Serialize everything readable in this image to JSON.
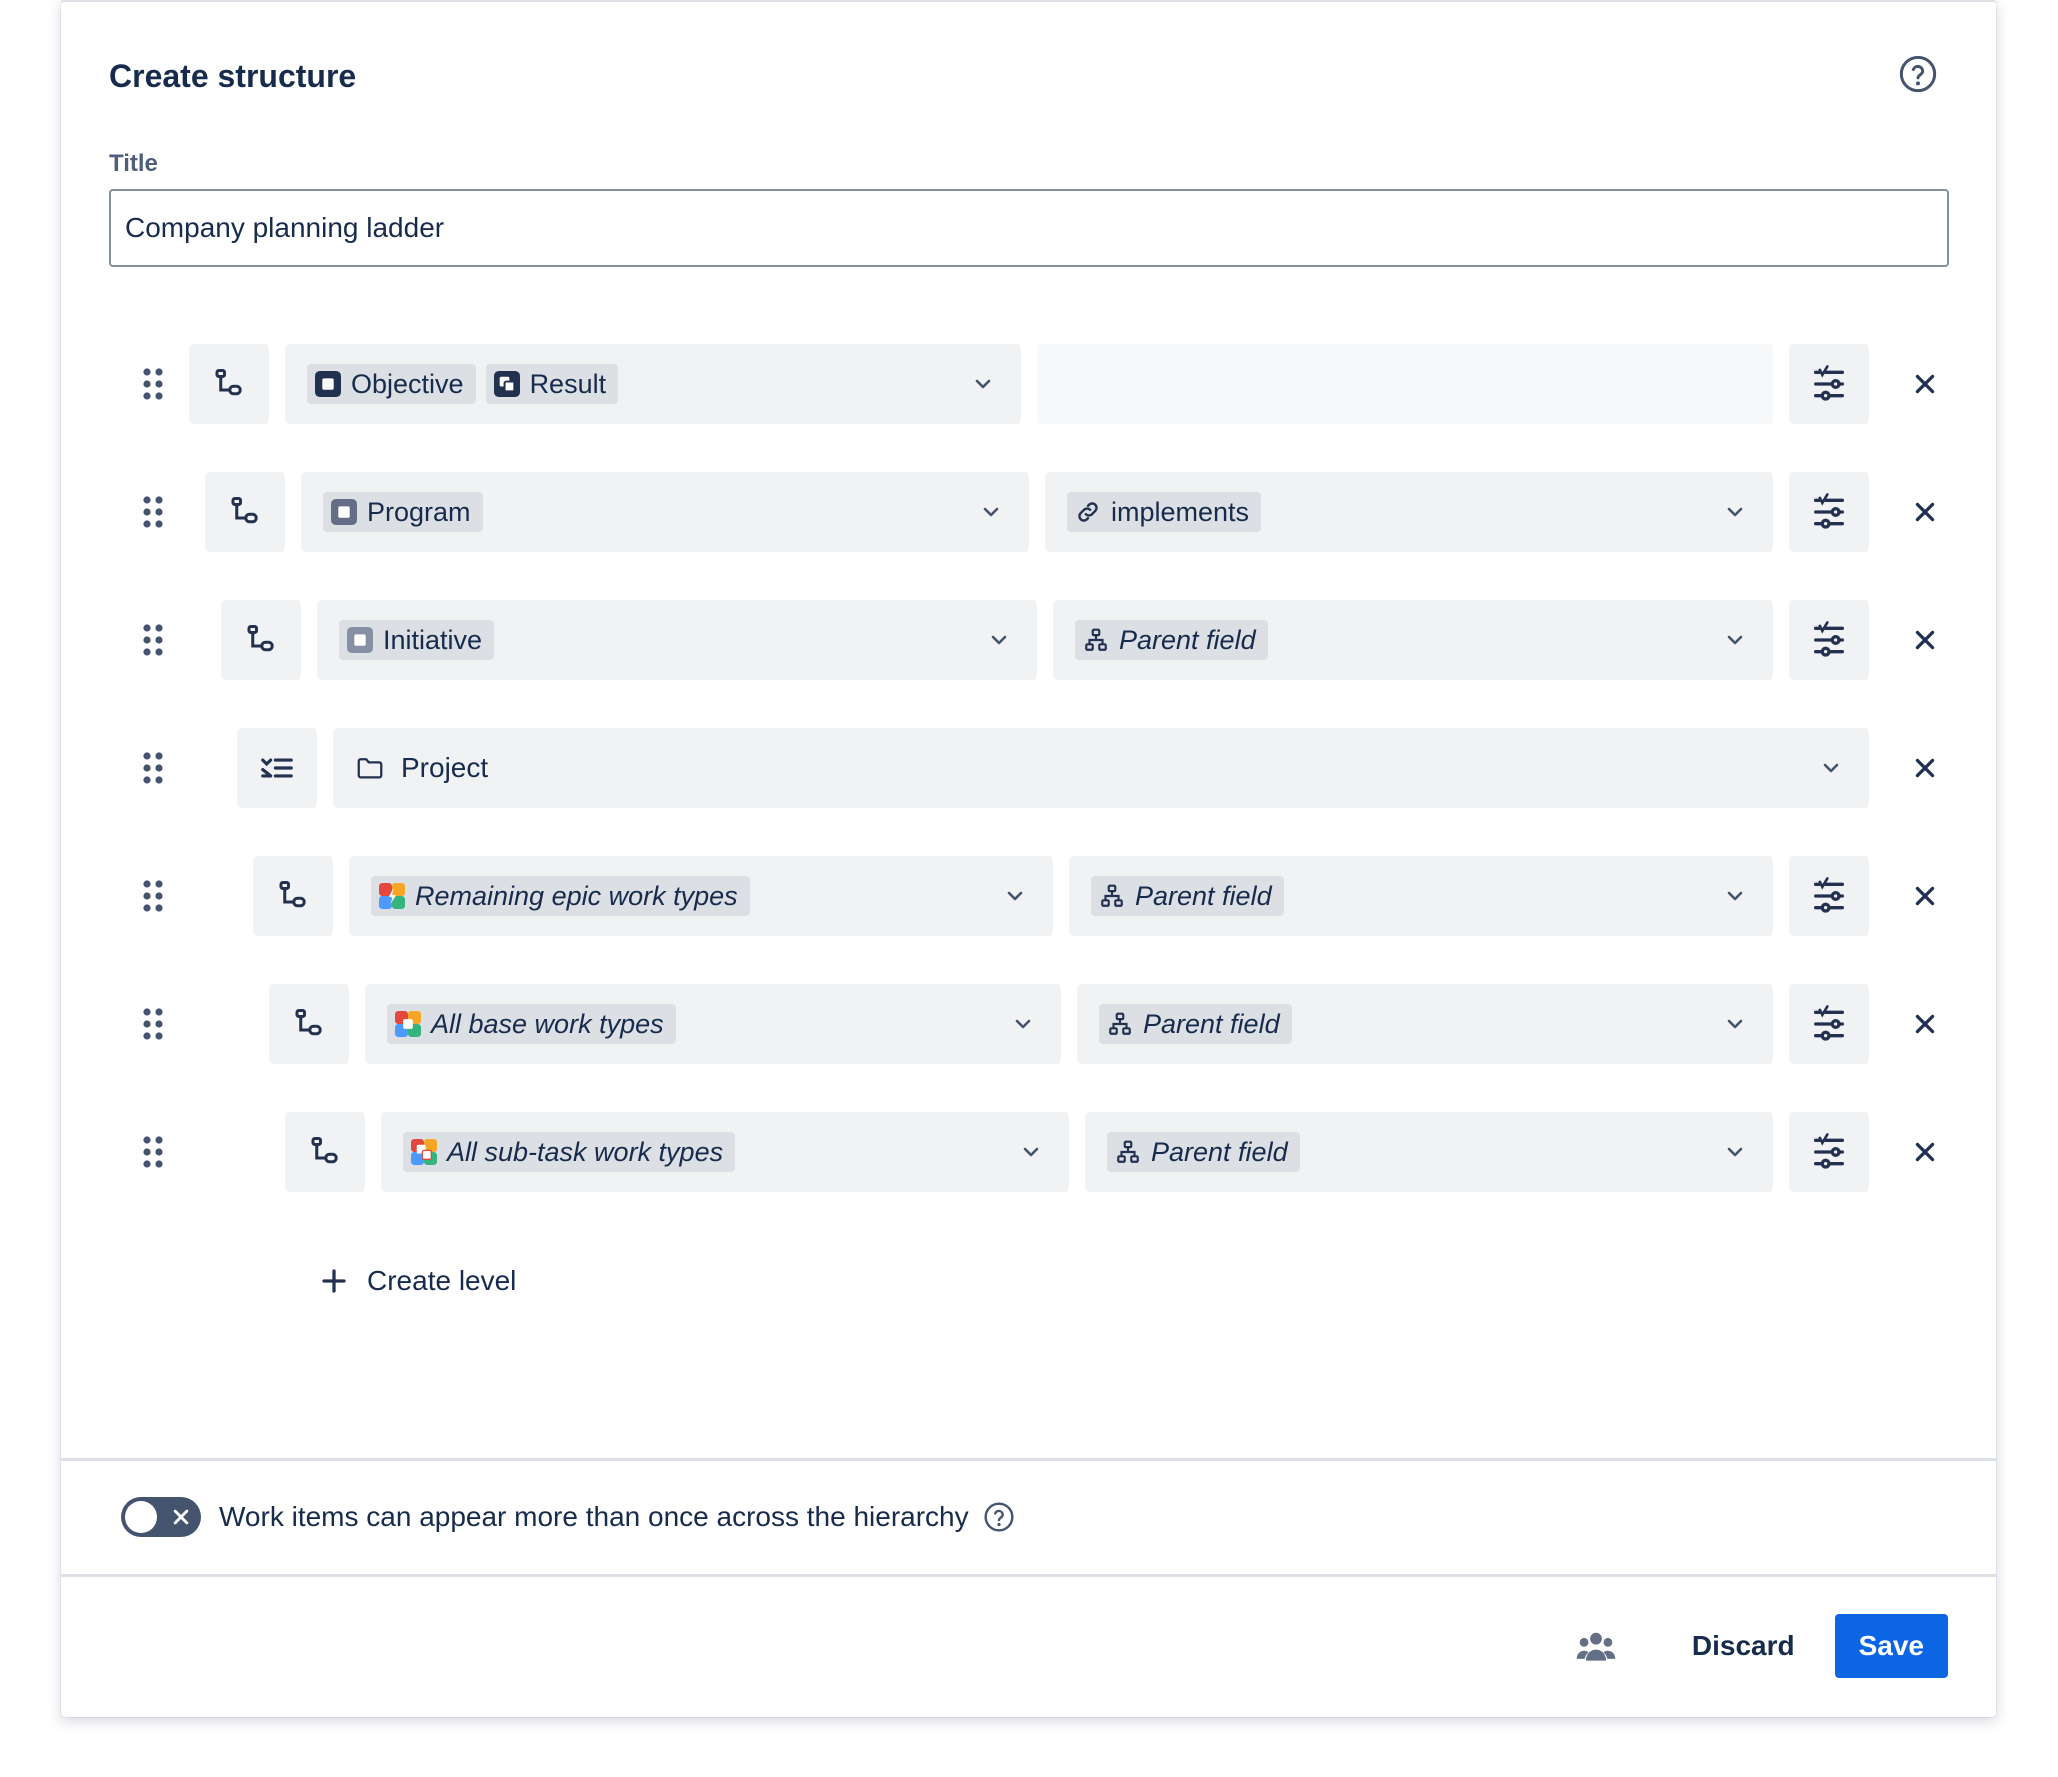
{
  "dialog": {
    "title": "Create structure",
    "help_icon": "question-circle-icon"
  },
  "title_field": {
    "label": "Title",
    "value": "Company planning ladder"
  },
  "levels": [
    {
      "mode_icon": "hierarchy-insert-icon",
      "items": [
        {
          "label": "Objective",
          "icon": "objective-icon"
        },
        {
          "label": "Result",
          "icon": "result-icon"
        }
      ],
      "relation": null
    },
    {
      "mode_icon": "hierarchy-insert-icon",
      "items": [
        {
          "label": "Program",
          "icon": "program-icon"
        }
      ],
      "relation": {
        "label": "implements",
        "icon": "link-icon"
      }
    },
    {
      "mode_icon": "hierarchy-insert-icon",
      "items": [
        {
          "label": "Initiative",
          "icon": "initiative-icon"
        }
      ],
      "relation": {
        "label": "Parent field",
        "icon": "hierarchy-icon"
      }
    },
    {
      "mode_icon": "group-by-icon",
      "value": {
        "label": "Project",
        "icon": "folder-icon"
      }
    },
    {
      "mode_icon": "hierarchy-insert-icon",
      "items": [
        {
          "label": "Remaining epic work types",
          "icon": "epic-types-icon"
        }
      ],
      "relation": {
        "label": "Parent field",
        "icon": "hierarchy-icon"
      }
    },
    {
      "mode_icon": "hierarchy-insert-icon",
      "items": [
        {
          "label": "All base work types",
          "icon": "base-types-icon"
        }
      ],
      "relation": {
        "label": "Parent field",
        "icon": "hierarchy-icon"
      }
    },
    {
      "mode_icon": "hierarchy-insert-icon",
      "items": [
        {
          "label": "All sub-task work types",
          "icon": "subtask-types-icon"
        }
      ],
      "relation": {
        "label": "Parent field",
        "icon": "hierarchy-icon"
      }
    }
  ],
  "create_level": {
    "label": "Create level",
    "icon": "plus-icon"
  },
  "duplicates_toggle": {
    "label": "Work items can appear more than once across the hierarchy",
    "state": "off"
  },
  "footer": {
    "team_icon": "people-group-icon",
    "discard_label": "Discard",
    "save_label": "Save"
  },
  "colors": {
    "primary": "#0c66e4",
    "text": "#172b4d",
    "chip_bg": "#dcdfe4",
    "field_bg": "#f1f2f4",
    "dark_icon": "#22314f",
    "toggle_off": "#44546f"
  }
}
